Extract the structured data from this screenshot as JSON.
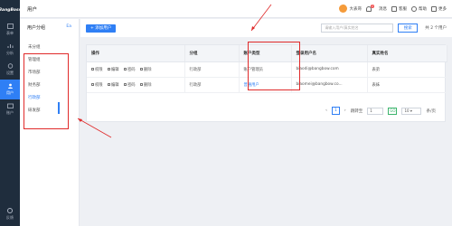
{
  "app": {
    "logo": "BangBoss",
    "page_title": "用户"
  },
  "leftnav": {
    "items": [
      {
        "label": "表单",
        "icon": "form-icon"
      },
      {
        "label": "分析",
        "icon": "chart-icon"
      },
      {
        "label": "设置",
        "icon": "settings-icon"
      },
      {
        "label": "用户",
        "icon": "user-icon",
        "active": true
      },
      {
        "label": "账户",
        "icon": "account-icon"
      }
    ],
    "bottom_label": "反馈"
  },
  "header": {
    "user_name": "大表哥",
    "messages_label": "消息",
    "messages_badge": "2",
    "desk_label": "客服",
    "help_label": "帮助",
    "more_label": "更多"
  },
  "groups": {
    "title": "用户分组",
    "edit_label": "Ea",
    "items": [
      {
        "label": "未分组"
      },
      {
        "label": "管理组"
      },
      {
        "label": "市场部"
      },
      {
        "label": "财务部"
      },
      {
        "label": "行政部",
        "active": true
      },
      {
        "label": "研发部"
      }
    ]
  },
  "toolbar": {
    "add_label": "+ 添加用户",
    "search_placeholder": "请输入用户/真实姓名",
    "search_label": "搜索",
    "count_label": "共 2 个用户"
  },
  "table": {
    "columns": [
      "操作",
      "分组",
      "账户类型",
      "登录用户名",
      "真实姓名"
    ],
    "actions": [
      "权限",
      "编辑",
      "密码",
      "删除"
    ],
    "rows": [
      {
        "group": "行政部",
        "type": "账户管理员",
        "email": "biaodi@bangbow.com",
        "name": "表弟"
      },
      {
        "group": "行政部",
        "type": "普通用户",
        "email": "biaomei@bangbow.co...",
        "name": "表妹"
      }
    ]
  },
  "pager": {
    "prev": "‹",
    "page": "1",
    "next": "›",
    "goto_label": "跳转至",
    "goto_value": "1",
    "go_label": "GO",
    "page_size": "10",
    "per_page_label": "条/页"
  },
  "colors": {
    "accent": "#2f7ff5",
    "annotation": "#e02a2a",
    "nav_bg": "#1f2d3d"
  }
}
